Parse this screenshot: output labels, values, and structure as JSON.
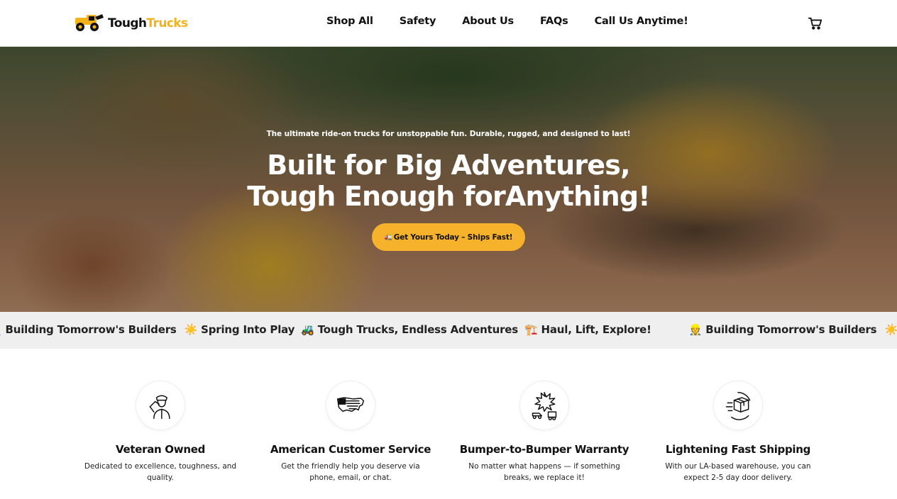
{
  "header": {
    "logo": {
      "text_dark": "Tough",
      "text_accent": "Trucks",
      "icon": "truck-logo-icon"
    },
    "nav": [
      {
        "label": "Shop All"
      },
      {
        "label": "Safety"
      },
      {
        "label": "About Us"
      },
      {
        "label": "FAQs"
      },
      {
        "label": "Call Us Anytime!"
      }
    ],
    "cart_icon": "cart-icon"
  },
  "hero": {
    "subtitle": "The ultimate ride-on trucks for unstoppable fun. Durable, rugged, and designed to last!",
    "title_line1": "Built for Big Adventures,",
    "title_line2": "Tough Enough forAnything!",
    "cta_icon": "🚛",
    "cta_label": "Get Yours Today – Ships Fast!"
  },
  "marquee": {
    "items": [
      "👷 Building Tomorrow's Builders",
      "☀️ Spring Into Play",
      "🚜 Tough Trucks, Endless Adventures",
      "🏗️ Haul, Lift, Explore!"
    ]
  },
  "features": [
    {
      "icon": "saluting-soldier-icon",
      "title": "Veteran Owned",
      "text": "Dedicated to excellence, toughness, and quality."
    },
    {
      "icon": "usa-map-flag-icon",
      "title": "American Customer Service",
      "text": "Get the friendly help you deserve via phone, email, or chat."
    },
    {
      "icon": "car-crash-icon",
      "title": "Bumper-to-Bumper Warranty",
      "text": "No matter what happens — if something breaks, we replace it!"
    },
    {
      "icon": "fast-shipping-box-icon",
      "title": "Lightening Fast Shipping",
      "text": "With our LA-based warehouse, you can expect 2-5 day door delivery."
    }
  ],
  "colors": {
    "accent": "#f7b22c",
    "logo_accent": "#f2b21a",
    "marquee_bg": "#efefef"
  }
}
